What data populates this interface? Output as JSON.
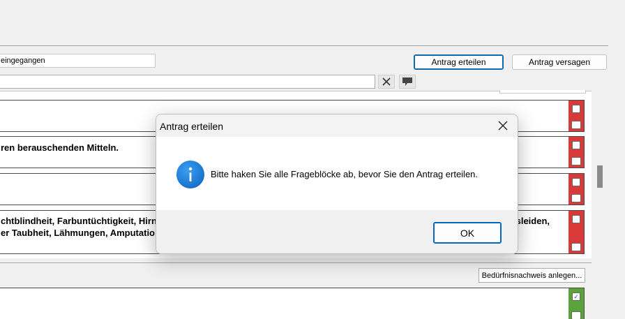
{
  "toolbar": {
    "status_value": "eingegangen",
    "comment_value": "",
    "grant_label": "Antrag erteilen",
    "deny_label": "Antrag versagen",
    "clear_icon": "close-icon",
    "comment_icon": "comment-icon"
  },
  "rows": [
    {
      "text": ""
    },
    {
      "text": "ren berauschenden Mitteln."
    },
    {
      "text": ""
    },
    {
      "text_line1": "chtblindheit, Farbuntüchtigkeit, Hirn",
      "text_line2": "er Taubheit, Lähmungen, Amputatio",
      "text_right": "lsleiden,"
    }
  ],
  "lower": {
    "beduerfnis_label": "Bedürfnisnachweis anlegen..."
  },
  "dialog": {
    "title": "Antrag erteilen",
    "message": "Bitte haken Sie alle Frageblöcke ab, bevor Sie den Antrag erteilen.",
    "ok_label": "OK",
    "icon": "info-icon"
  },
  "colors": {
    "flag_red": "#d83a3a",
    "flag_green": "#5aa33a",
    "accent": "#0067c0"
  }
}
